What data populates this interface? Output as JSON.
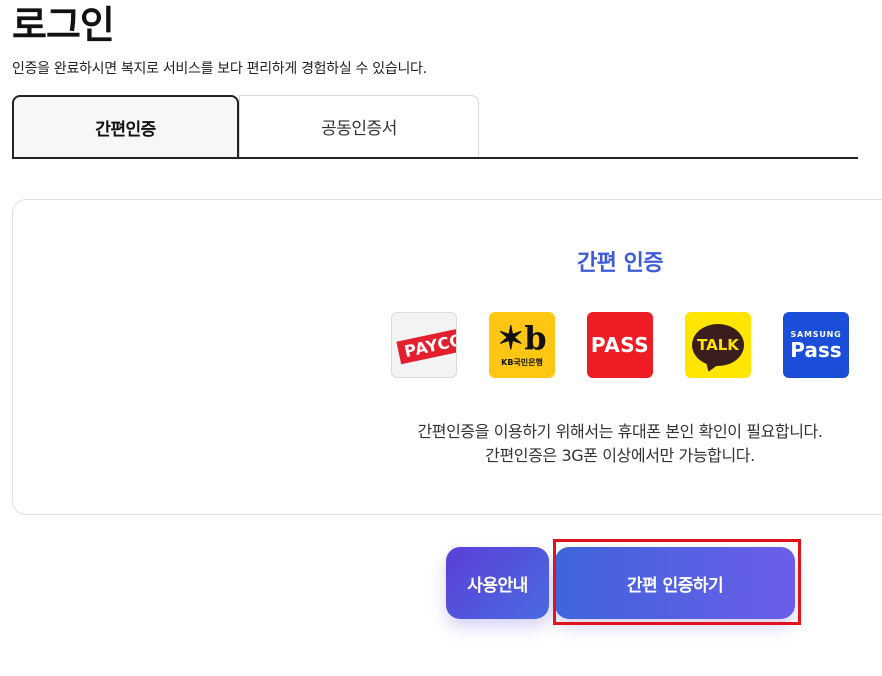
{
  "page": {
    "title": "로그인",
    "subtitle": "인증을 완료하시면 복지로 서비스를 보다 편리하게 경험하실 수 있습니다."
  },
  "tabs": [
    {
      "label": "간편인증",
      "active": true
    },
    {
      "label": "공동인증서",
      "active": false
    }
  ],
  "card": {
    "title": "간편 인증",
    "providers": [
      {
        "name": "payco",
        "label": "PAYCO",
        "color": "#e4202e"
      },
      {
        "name": "kb",
        "label": "KB국민은행",
        "color": "#ffc713"
      },
      {
        "name": "pass",
        "label": "PASS",
        "color": "#ee1c25"
      },
      {
        "name": "kakao",
        "label": "TALK",
        "color": "#ffe500"
      },
      {
        "name": "samsung",
        "label_top": "SAMSUNG",
        "label": "Pass",
        "color": "#1a4ed8"
      }
    ],
    "desc_line1": "간편인증을 이용하기 위해서는 휴대폰 본인 확인이 필요합니다.",
    "desc_line2": "간편인증은 3G폰 이상에서만 가능합니다."
  },
  "buttons": {
    "guide": "사용안내",
    "auth": "간편 인증하기"
  },
  "colors": {
    "accent": "#3d5bd6",
    "highlight": "#e0141c"
  }
}
